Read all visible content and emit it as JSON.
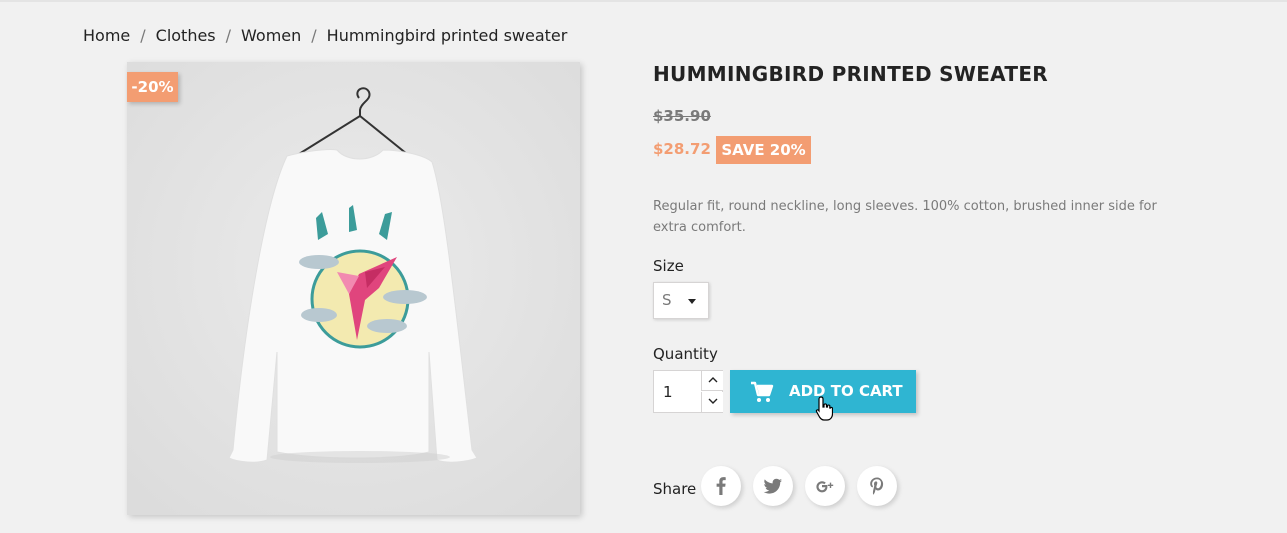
{
  "breadcrumb": {
    "items": [
      "Home",
      "Clothes",
      "Women",
      "Hummingbird printed sweater"
    ],
    "separator": "/"
  },
  "product": {
    "discount_flag": "-20%",
    "title": "HUMMINGBIRD PRINTED SWEATER",
    "old_price": "$35.90",
    "price": "$28.72",
    "save_badge": "SAVE 20%",
    "description": "Regular fit, round neckline, long sleeves. 100% cotton, brushed inner side for extra comfort."
  },
  "options": {
    "size_label": "Size",
    "size_value": "S",
    "quantity_label": "Quantity",
    "quantity_value": "1"
  },
  "actions": {
    "add_to_cart_label": "ADD TO CART"
  },
  "share": {
    "label": "Share",
    "networks": [
      "facebook-icon",
      "twitter-icon",
      "google-plus-icon",
      "pinterest-icon"
    ]
  },
  "colors": {
    "accent": "#2fb5d2",
    "discount": "#f39d72",
    "background": "#f1f1f1"
  }
}
